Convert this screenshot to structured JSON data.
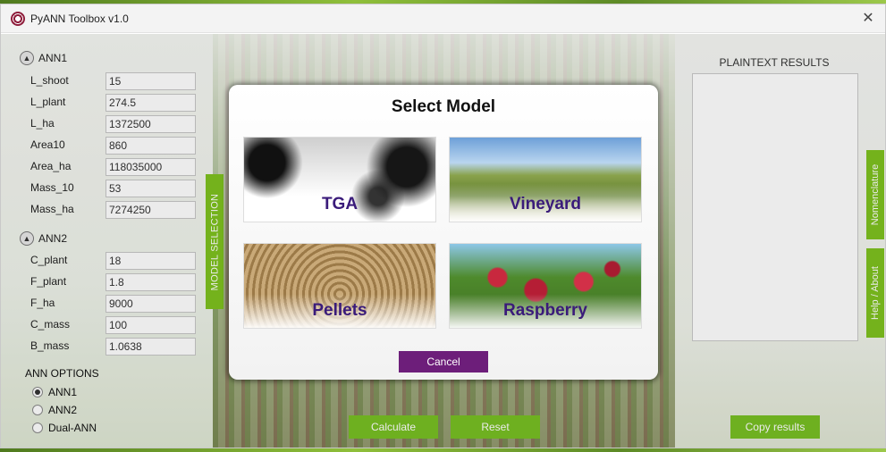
{
  "window": {
    "title": "PyANN Toolbox v1.0",
    "close_glyph": "✕",
    "icon": "app-logo-icon"
  },
  "left": {
    "ann1": {
      "header": "ANN1",
      "params": [
        {
          "label": "L_shoot",
          "value": "15"
        },
        {
          "label": "L_plant",
          "value": "274.5"
        },
        {
          "label": "L_ha",
          "value": "1372500"
        },
        {
          "label": "Area10",
          "value": "860"
        },
        {
          "label": "Area_ha",
          "value": "118035000"
        },
        {
          "label": "Mass_10",
          "value": "53"
        },
        {
          "label": "Mass_ha",
          "value": "7274250"
        }
      ]
    },
    "ann2": {
      "header": "ANN2",
      "params": [
        {
          "label": "C_plant",
          "value": "18"
        },
        {
          "label": "F_plant",
          "value": "1.8"
        },
        {
          "label": "F_ha",
          "value": "9000"
        },
        {
          "label": "C_mass",
          "value": "100"
        },
        {
          "label": "B_mass",
          "value": "1.0638"
        }
      ]
    },
    "options": {
      "title": "ANN OPTIONS",
      "radios": [
        {
          "label": "ANN1",
          "checked": true
        },
        {
          "label": "ANN2",
          "checked": false
        },
        {
          "label": "Dual-ANN",
          "checked": false
        }
      ]
    },
    "model_selection_tab": "MODEL SELECTION"
  },
  "center": {
    "calculate_label": "Calculate",
    "reset_label": "Reset"
  },
  "right": {
    "results_title": "PLAINTEXT RESULTS",
    "copy_label": "Copy results",
    "nomenclature_tab": "Nomenclature",
    "help_tab": "Help / About"
  },
  "modal": {
    "title": "Select Model",
    "cards": [
      "TGA",
      "Vineyard",
      "Pellets",
      "Raspberry"
    ],
    "cancel_label": "Cancel"
  },
  "colors": {
    "accent_green": "#7ec21f",
    "modal_button": "#6d1e7a",
    "card_text": "#3a1b7a"
  }
}
